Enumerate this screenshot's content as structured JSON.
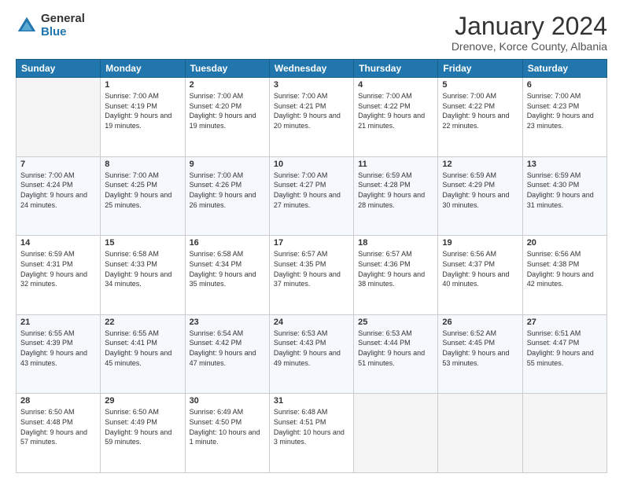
{
  "header": {
    "logo_general": "General",
    "logo_blue": "Blue",
    "title": "January 2024",
    "location": "Drenove, Korce County, Albania"
  },
  "days": [
    "Sunday",
    "Monday",
    "Tuesday",
    "Wednesday",
    "Thursday",
    "Friday",
    "Saturday"
  ],
  "weeks": [
    [
      {
        "date": "",
        "sunrise": "",
        "sunset": "",
        "daylight": ""
      },
      {
        "date": "1",
        "sunrise": "Sunrise: 7:00 AM",
        "sunset": "Sunset: 4:19 PM",
        "daylight": "Daylight: 9 hours and 19 minutes."
      },
      {
        "date": "2",
        "sunrise": "Sunrise: 7:00 AM",
        "sunset": "Sunset: 4:20 PM",
        "daylight": "Daylight: 9 hours and 19 minutes."
      },
      {
        "date": "3",
        "sunrise": "Sunrise: 7:00 AM",
        "sunset": "Sunset: 4:21 PM",
        "daylight": "Daylight: 9 hours and 20 minutes."
      },
      {
        "date": "4",
        "sunrise": "Sunrise: 7:00 AM",
        "sunset": "Sunset: 4:22 PM",
        "daylight": "Daylight: 9 hours and 21 minutes."
      },
      {
        "date": "5",
        "sunrise": "Sunrise: 7:00 AM",
        "sunset": "Sunset: 4:22 PM",
        "daylight": "Daylight: 9 hours and 22 minutes."
      },
      {
        "date": "6",
        "sunrise": "Sunrise: 7:00 AM",
        "sunset": "Sunset: 4:23 PM",
        "daylight": "Daylight: 9 hours and 23 minutes."
      }
    ],
    [
      {
        "date": "7",
        "sunrise": "Sunrise: 7:00 AM",
        "sunset": "Sunset: 4:24 PM",
        "daylight": "Daylight: 9 hours and 24 minutes."
      },
      {
        "date": "8",
        "sunrise": "Sunrise: 7:00 AM",
        "sunset": "Sunset: 4:25 PM",
        "daylight": "Daylight: 9 hours and 25 minutes."
      },
      {
        "date": "9",
        "sunrise": "Sunrise: 7:00 AM",
        "sunset": "Sunset: 4:26 PM",
        "daylight": "Daylight: 9 hours and 26 minutes."
      },
      {
        "date": "10",
        "sunrise": "Sunrise: 7:00 AM",
        "sunset": "Sunset: 4:27 PM",
        "daylight": "Daylight: 9 hours and 27 minutes."
      },
      {
        "date": "11",
        "sunrise": "Sunrise: 6:59 AM",
        "sunset": "Sunset: 4:28 PM",
        "daylight": "Daylight: 9 hours and 28 minutes."
      },
      {
        "date": "12",
        "sunrise": "Sunrise: 6:59 AM",
        "sunset": "Sunset: 4:29 PM",
        "daylight": "Daylight: 9 hours and 30 minutes."
      },
      {
        "date": "13",
        "sunrise": "Sunrise: 6:59 AM",
        "sunset": "Sunset: 4:30 PM",
        "daylight": "Daylight: 9 hours and 31 minutes."
      }
    ],
    [
      {
        "date": "14",
        "sunrise": "Sunrise: 6:59 AM",
        "sunset": "Sunset: 4:31 PM",
        "daylight": "Daylight: 9 hours and 32 minutes."
      },
      {
        "date": "15",
        "sunrise": "Sunrise: 6:58 AM",
        "sunset": "Sunset: 4:33 PM",
        "daylight": "Daylight: 9 hours and 34 minutes."
      },
      {
        "date": "16",
        "sunrise": "Sunrise: 6:58 AM",
        "sunset": "Sunset: 4:34 PM",
        "daylight": "Daylight: 9 hours and 35 minutes."
      },
      {
        "date": "17",
        "sunrise": "Sunrise: 6:57 AM",
        "sunset": "Sunset: 4:35 PM",
        "daylight": "Daylight: 9 hours and 37 minutes."
      },
      {
        "date": "18",
        "sunrise": "Sunrise: 6:57 AM",
        "sunset": "Sunset: 4:36 PM",
        "daylight": "Daylight: 9 hours and 38 minutes."
      },
      {
        "date": "19",
        "sunrise": "Sunrise: 6:56 AM",
        "sunset": "Sunset: 4:37 PM",
        "daylight": "Daylight: 9 hours and 40 minutes."
      },
      {
        "date": "20",
        "sunrise": "Sunrise: 6:56 AM",
        "sunset": "Sunset: 4:38 PM",
        "daylight": "Daylight: 9 hours and 42 minutes."
      }
    ],
    [
      {
        "date": "21",
        "sunrise": "Sunrise: 6:55 AM",
        "sunset": "Sunset: 4:39 PM",
        "daylight": "Daylight: 9 hours and 43 minutes."
      },
      {
        "date": "22",
        "sunrise": "Sunrise: 6:55 AM",
        "sunset": "Sunset: 4:41 PM",
        "daylight": "Daylight: 9 hours and 45 minutes."
      },
      {
        "date": "23",
        "sunrise": "Sunrise: 6:54 AM",
        "sunset": "Sunset: 4:42 PM",
        "daylight": "Daylight: 9 hours and 47 minutes."
      },
      {
        "date": "24",
        "sunrise": "Sunrise: 6:53 AM",
        "sunset": "Sunset: 4:43 PM",
        "daylight": "Daylight: 9 hours and 49 minutes."
      },
      {
        "date": "25",
        "sunrise": "Sunrise: 6:53 AM",
        "sunset": "Sunset: 4:44 PM",
        "daylight": "Daylight: 9 hours and 51 minutes."
      },
      {
        "date": "26",
        "sunrise": "Sunrise: 6:52 AM",
        "sunset": "Sunset: 4:45 PM",
        "daylight": "Daylight: 9 hours and 53 minutes."
      },
      {
        "date": "27",
        "sunrise": "Sunrise: 6:51 AM",
        "sunset": "Sunset: 4:47 PM",
        "daylight": "Daylight: 9 hours and 55 minutes."
      }
    ],
    [
      {
        "date": "28",
        "sunrise": "Sunrise: 6:50 AM",
        "sunset": "Sunset: 4:48 PM",
        "daylight": "Daylight: 9 hours and 57 minutes."
      },
      {
        "date": "29",
        "sunrise": "Sunrise: 6:50 AM",
        "sunset": "Sunset: 4:49 PM",
        "daylight": "Daylight: 9 hours and 59 minutes."
      },
      {
        "date": "30",
        "sunrise": "Sunrise: 6:49 AM",
        "sunset": "Sunset: 4:50 PM",
        "daylight": "Daylight: 10 hours and 1 minute."
      },
      {
        "date": "31",
        "sunrise": "Sunrise: 6:48 AM",
        "sunset": "Sunset: 4:51 PM",
        "daylight": "Daylight: 10 hours and 3 minutes."
      },
      {
        "date": "",
        "sunrise": "",
        "sunset": "",
        "daylight": ""
      },
      {
        "date": "",
        "sunrise": "",
        "sunset": "",
        "daylight": ""
      },
      {
        "date": "",
        "sunrise": "",
        "sunset": "",
        "daylight": ""
      }
    ]
  ]
}
